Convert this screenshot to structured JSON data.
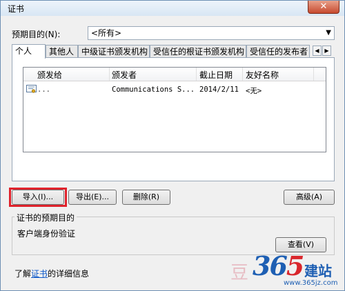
{
  "window": {
    "title": "证书",
    "close_label": "✕"
  },
  "purpose": {
    "label": "预期目的(N):",
    "selected": "<所有>"
  },
  "tabs": [
    {
      "label": "个人"
    },
    {
      "label": "其他人"
    },
    {
      "label": "中级证书颁发机构"
    },
    {
      "label": "受信任的根证书颁发机构"
    },
    {
      "label": "受信任的发布者"
    }
  ],
  "list": {
    "columns": [
      "颁发给",
      "颁发者",
      "截止日期",
      "友好名称"
    ],
    "rows": [
      {
        "issued_to": "        ...",
        "issuer": "Communications S...",
        "expiration": "2014/2/11",
        "friendly_name": "<无>"
      }
    ]
  },
  "buttons": {
    "import": "导入(I)...",
    "export": "导出(E)...",
    "remove": "删除(R)",
    "advanced": "高级(A)",
    "view": "查看(V)"
  },
  "purposes_group": {
    "title": "证书的预期目的",
    "value": "客户端身份验证"
  },
  "learn_more": {
    "prefix": "了解",
    "link": "证书",
    "suffix": "的详细信息"
  },
  "watermark": {
    "char": "豆",
    "digits_a": "3",
    "digits_b": "6",
    "digits_c": "5",
    "brand": "建站",
    "url": "www.365jz.com"
  },
  "colors": {
    "highlight": "#e0222c",
    "link": "#0a56c8",
    "brand_blue": "#1e5fb3"
  }
}
